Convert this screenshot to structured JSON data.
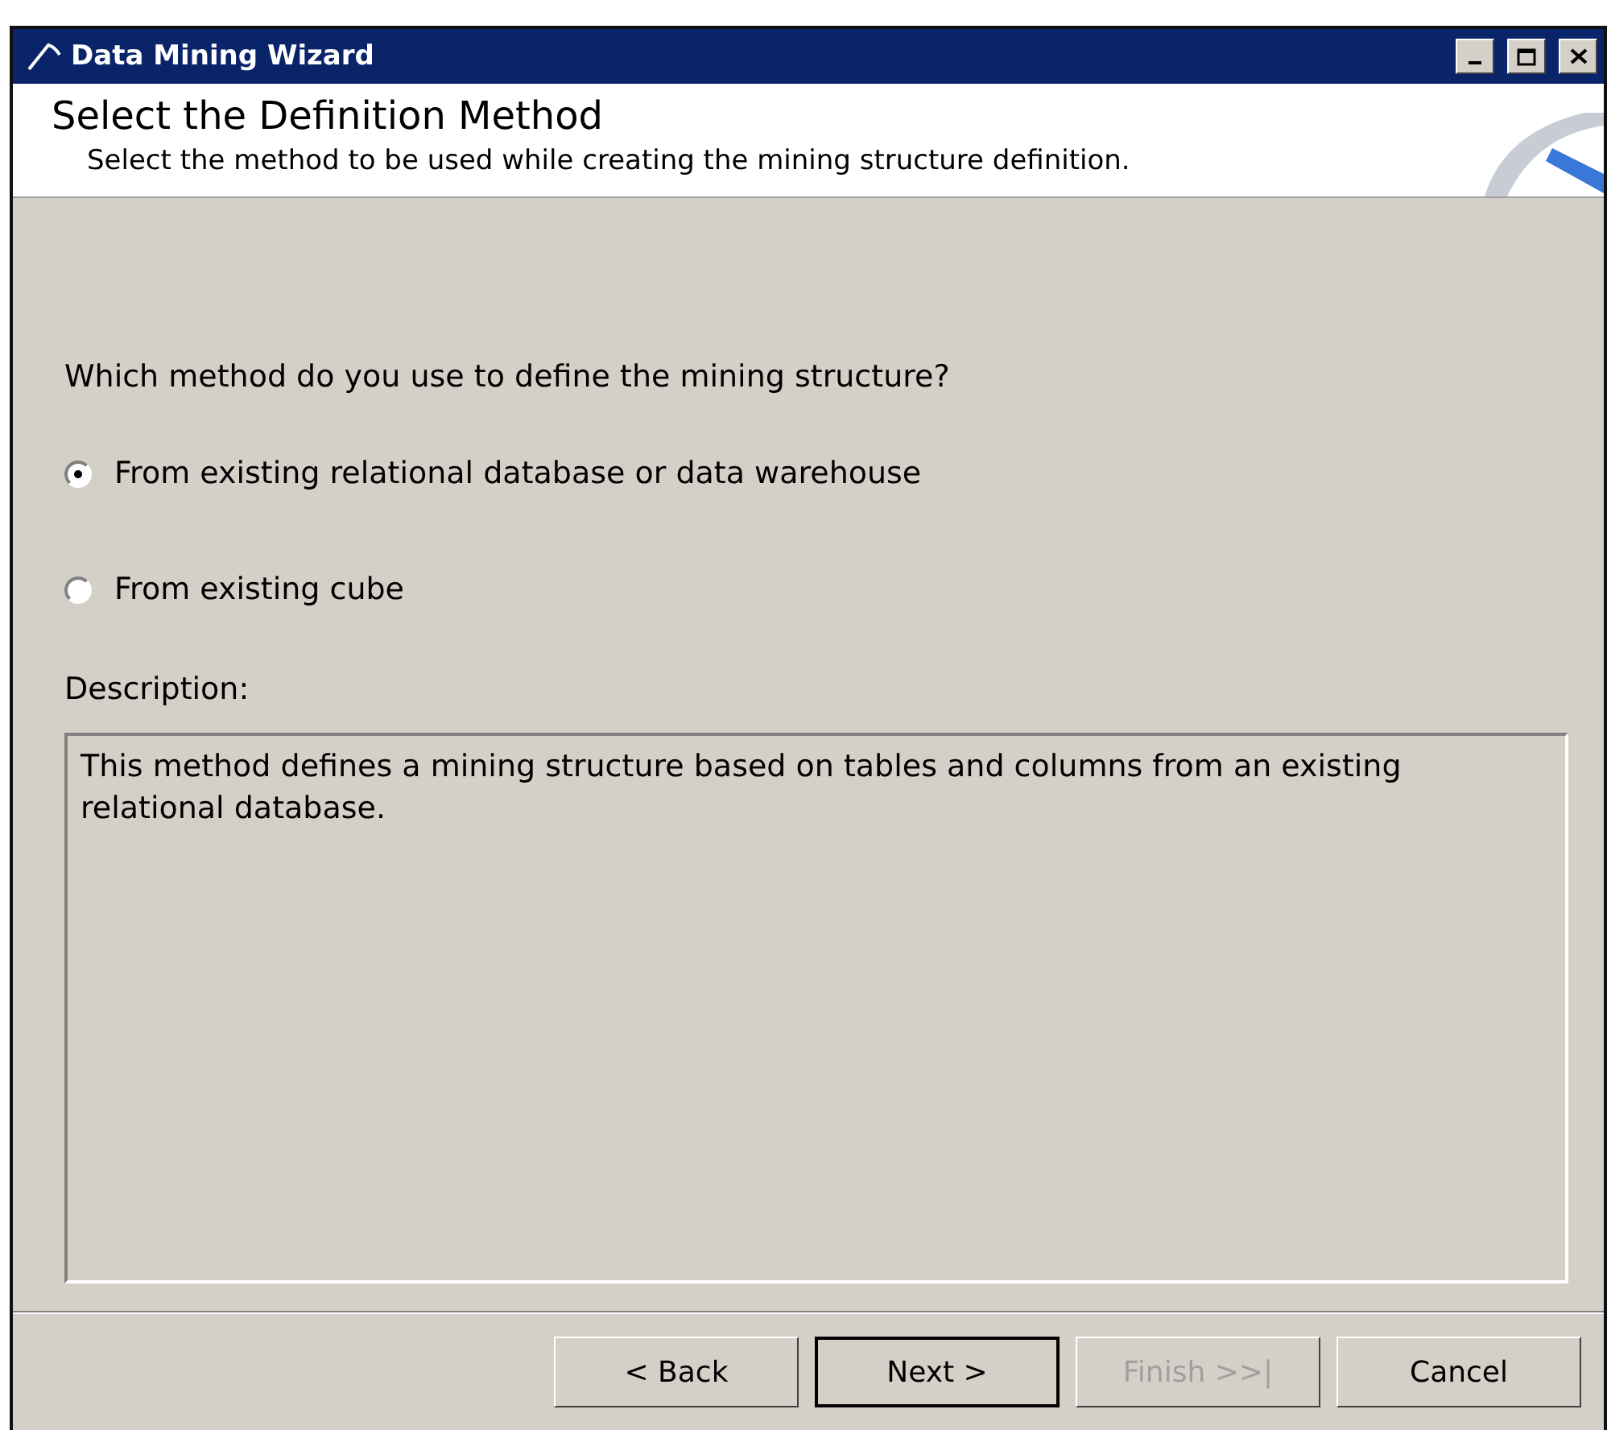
{
  "window": {
    "title": "Data Mining Wizard"
  },
  "header": {
    "title": "Select the Definition Method",
    "subtitle": "Select the method to be used while creating the mining structure definition."
  },
  "question": "Which method do you use to define the mining structure?",
  "options": [
    {
      "label": "From existing relational database or data warehouse",
      "selected": true
    },
    {
      "label": "From existing cube",
      "selected": false
    }
  ],
  "description": {
    "label": "Description:",
    "text": "This method defines a mining structure based on tables and columns from an existing relational database."
  },
  "buttons": [
    {
      "label": "< Back",
      "disabled": false,
      "default": false
    },
    {
      "label": "Next >",
      "disabled": false,
      "default": true
    },
    {
      "label": "Finish >>|",
      "disabled": true,
      "default": false
    },
    {
      "label": "Cancel",
      "disabled": false,
      "default": false
    }
  ]
}
